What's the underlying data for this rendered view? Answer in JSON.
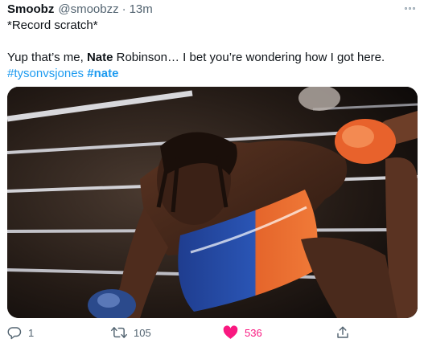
{
  "tweet": {
    "display_name": "Smoobz",
    "handle": "@smoobzz",
    "separator": "·",
    "time": "13m",
    "line1": "*Record scratch*",
    "line2_a": "Yup that’s me, ",
    "line2_bold": "Nate",
    "line2_b": " Robinson… I bet you’re wondering how I got here.",
    "hashtag1": "#tysonvsjones",
    "hashtag2": "#nate"
  },
  "actions": {
    "replies": "1",
    "retweets": "105",
    "likes": "536",
    "liked": true
  },
  "icons": {
    "more": "more-options-icon",
    "reply": "reply-icon",
    "retweet": "retweet-icon",
    "like": "heart-icon",
    "share": "share-icon"
  },
  "colors": {
    "link": "#1d9bf0",
    "like": "#f91880",
    "muted": "#536471"
  }
}
